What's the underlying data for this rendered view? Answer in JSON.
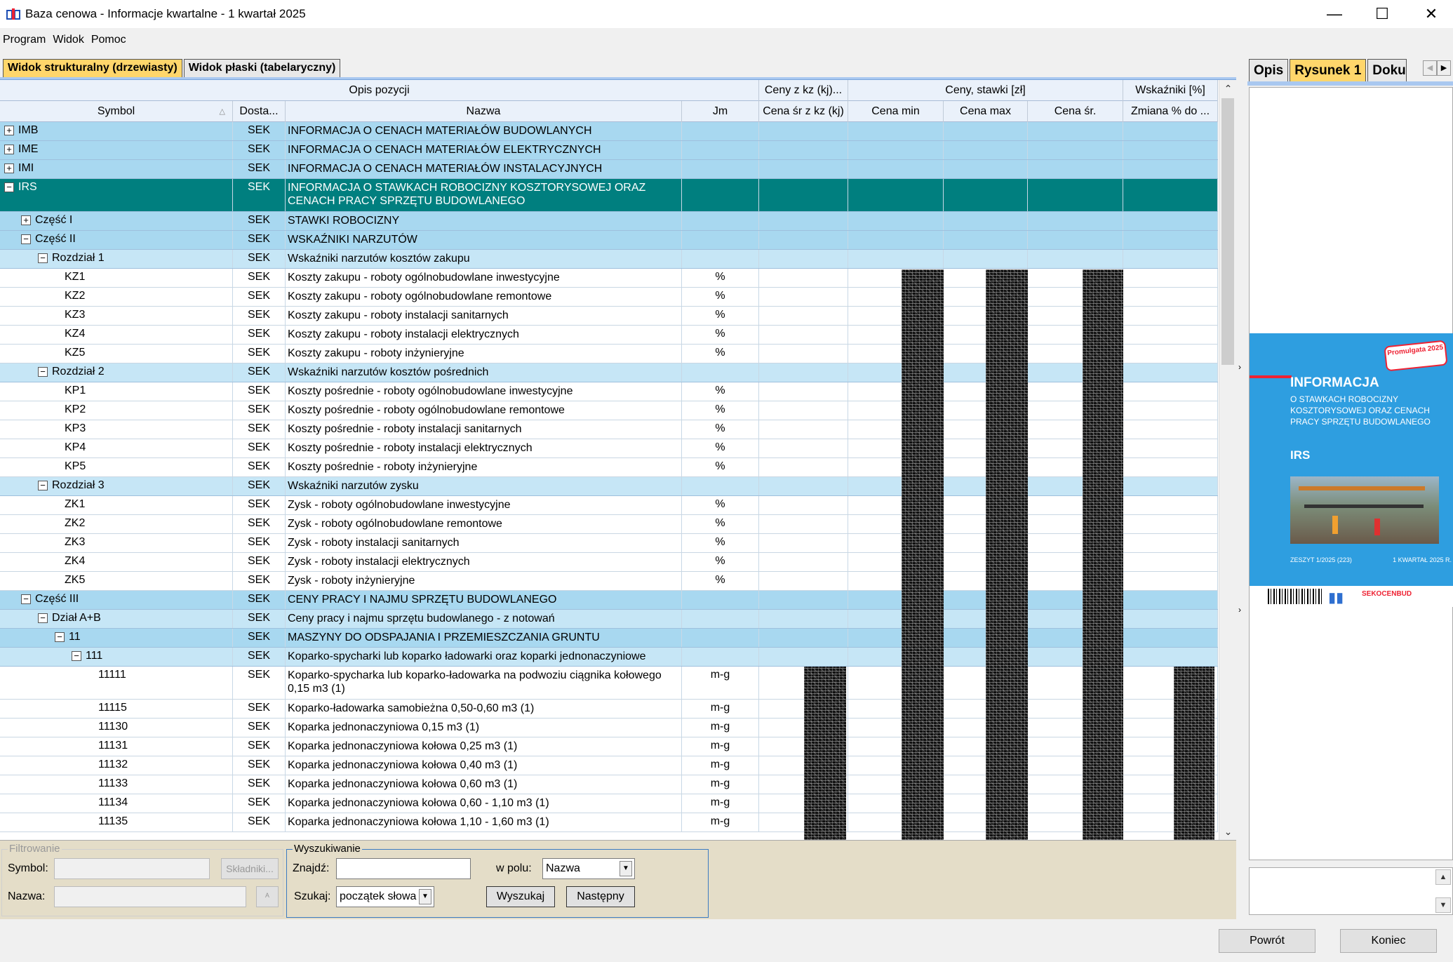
{
  "window": {
    "title": "Baza cenowa - Informacje kwartalne - 1 kwartał 2025",
    "minimize": "—",
    "maximize": "☐",
    "close": "✕"
  },
  "menu": [
    "Program",
    "Widok",
    "Pomoc"
  ],
  "tabs": [
    "Widok strukturalny (drzewiasty)",
    "Widok płaski (tabelaryczny)"
  ],
  "header_groups": [
    "Opis pozycji",
    "Ceny z kz (kj)...",
    "Ceny, stawki [zł]",
    "Wskaźniki [%]"
  ],
  "columns": [
    "Symbol",
    "Dosta...",
    "Nazwa",
    "Jm",
    "Cena śr z kz (kj)",
    "Cena min",
    "Cena max",
    "Cena śr.",
    "Zmiana % do ..."
  ],
  "rows": [
    {
      "level": 0,
      "sign": "+",
      "symbol": "IMB",
      "dost": "SEK",
      "name": "INFORMACJA O CENACH MATERIAŁÓW BUDOWLANYCH",
      "jm": "",
      "type": "grp"
    },
    {
      "level": 0,
      "sign": "+",
      "symbol": "IME",
      "dost": "SEK",
      "name": "INFORMACJA O CENACH MATERIAŁÓW ELEKTRYCZNYCH",
      "jm": "",
      "type": "grp"
    },
    {
      "level": 0,
      "sign": "+",
      "symbol": "IMI",
      "dost": "SEK",
      "name": "INFORMACJA O CENACH MATERIAŁÓW INSTALACYJNYCH",
      "jm": "",
      "type": "grp"
    },
    {
      "level": 0,
      "sign": "−",
      "symbol": "IRS",
      "dost": "SEK",
      "name": "INFORMACJA O STAWKACH ROBOCIZNY KOSZTORYSOWEJ ORAZ CENACH PRACY SPRZĘTU BUDOWLANEGO",
      "jm": "",
      "type": "sel"
    },
    {
      "level": 1,
      "sign": "+",
      "symbol": "Część I",
      "dost": "SEK",
      "name": "STAWKI ROBOCIZNY",
      "jm": "",
      "type": "grp"
    },
    {
      "level": 1,
      "sign": "−",
      "symbol": "Część II",
      "dost": "SEK",
      "name": "WSKAŹNIKI NARZUTÓW",
      "jm": "",
      "type": "grp"
    },
    {
      "level": 2,
      "sign": "−",
      "symbol": "Rozdział 1",
      "dost": "SEK",
      "name": "Wskaźniki narzutów kosztów zakupu",
      "jm": "",
      "type": "grp2"
    },
    {
      "level": 3,
      "sign": "",
      "symbol": "KZ1",
      "dost": "SEK",
      "name": "Koszty zakupu - roboty ogólnobudowlane inwestycyjne",
      "jm": "%",
      "type": "leaf"
    },
    {
      "level": 3,
      "sign": "",
      "symbol": "KZ2",
      "dost": "SEK",
      "name": "Koszty zakupu - roboty ogólnobudowlane remontowe",
      "jm": "%",
      "type": "leaf"
    },
    {
      "level": 3,
      "sign": "",
      "symbol": "KZ3",
      "dost": "SEK",
      "name": "Koszty zakupu - roboty instalacji sanitarnych",
      "jm": "%",
      "type": "leaf"
    },
    {
      "level": 3,
      "sign": "",
      "symbol": "KZ4",
      "dost": "SEK",
      "name": "Koszty zakupu - roboty instalacji elektrycznych",
      "jm": "%",
      "type": "leaf"
    },
    {
      "level": 3,
      "sign": "",
      "symbol": "KZ5",
      "dost": "SEK",
      "name": "Koszty zakupu - roboty inżynieryjne",
      "jm": "%",
      "type": "leaf"
    },
    {
      "level": 2,
      "sign": "−",
      "symbol": "Rozdział 2",
      "dost": "SEK",
      "name": "Wskaźniki narzutów kosztów pośrednich",
      "jm": "",
      "type": "grp2"
    },
    {
      "level": 3,
      "sign": "",
      "symbol": "KP1",
      "dost": "SEK",
      "name": "Koszty pośrednie - roboty ogólnobudowlane inwestycyjne",
      "jm": "%",
      "type": "leaf"
    },
    {
      "level": 3,
      "sign": "",
      "symbol": "KP2",
      "dost": "SEK",
      "name": "Koszty pośrednie - roboty ogólnobudowlane remontowe",
      "jm": "%",
      "type": "leaf"
    },
    {
      "level": 3,
      "sign": "",
      "symbol": "KP3",
      "dost": "SEK",
      "name": "Koszty pośrednie - roboty instalacji sanitarnych",
      "jm": "%",
      "type": "leaf"
    },
    {
      "level": 3,
      "sign": "",
      "symbol": "KP4",
      "dost": "SEK",
      "name": "Koszty pośrednie - roboty instalacji elektrycznych",
      "jm": "%",
      "type": "leaf"
    },
    {
      "level": 3,
      "sign": "",
      "symbol": "KP5",
      "dost": "SEK",
      "name": "Koszty pośrednie - roboty inżynieryjne",
      "jm": "%",
      "type": "leaf"
    },
    {
      "level": 2,
      "sign": "−",
      "symbol": "Rozdział 3",
      "dost": "SEK",
      "name": "Wskaźniki narzutów zysku",
      "jm": "",
      "type": "grp2"
    },
    {
      "level": 3,
      "sign": "",
      "symbol": "ZK1",
      "dost": "SEK",
      "name": "Zysk - roboty ogólnobudowlane inwestycyjne",
      "jm": "%",
      "type": "leaf"
    },
    {
      "level": 3,
      "sign": "",
      "symbol": "ZK2",
      "dost": "SEK",
      "name": "Zysk - roboty ogólnobudowlane remontowe",
      "jm": "%",
      "type": "leaf"
    },
    {
      "level": 3,
      "sign": "",
      "symbol": "ZK3",
      "dost": "SEK",
      "name": "Zysk - roboty instalacji sanitarnych",
      "jm": "%",
      "type": "leaf"
    },
    {
      "level": 3,
      "sign": "",
      "symbol": "ZK4",
      "dost": "SEK",
      "name": "Zysk - roboty instalacji elektrycznych",
      "jm": "%",
      "type": "leaf"
    },
    {
      "level": 3,
      "sign": "",
      "symbol": "ZK5",
      "dost": "SEK",
      "name": "Zysk - roboty inżynieryjne",
      "jm": "%",
      "type": "leaf"
    },
    {
      "level": 1,
      "sign": "−",
      "symbol": "Część III",
      "dost": "SEK",
      "name": "CENY PRACY I NAJMU SPRZĘTU BUDOWLANEGO",
      "jm": "",
      "type": "grp"
    },
    {
      "level": 2,
      "sign": "−",
      "symbol": "Dział A+B",
      "dost": "SEK",
      "name": "Ceny pracy i najmu sprzętu budowlanego - z notowań",
      "jm": "",
      "type": "grp2"
    },
    {
      "level": 3,
      "sign": "−",
      "symbol": "11",
      "dost": "SEK",
      "name": "MASZYNY DO ODSPAJANIA I PRZEMIESZCZANIA GRUNTU",
      "jm": "",
      "type": "grp"
    },
    {
      "level": 4,
      "sign": "−",
      "symbol": "111",
      "dost": "SEK",
      "name": "Koparko-spycharki lub koparko ładowarki oraz koparki jednonaczyniowe",
      "jm": "",
      "type": "grp2"
    },
    {
      "level": 5,
      "sign": "",
      "symbol": "11111",
      "dost": "SEK",
      "name": "Koparko-spycharka lub koparko-ładowarka na podwoziu ciągnika kołowego 0,15 m3 (1)",
      "jm": "m-g",
      "type": "leaf"
    },
    {
      "level": 5,
      "sign": "",
      "symbol": "11115",
      "dost": "SEK",
      "name": "Koparko-ładowarka samobieżna 0,50-0,60 m3 (1)",
      "jm": "m-g",
      "type": "leaf"
    },
    {
      "level": 5,
      "sign": "",
      "symbol": "11130",
      "dost": "SEK",
      "name": "Koparka jednonaczyniowa 0,15 m3 (1)",
      "jm": "m-g",
      "type": "leaf"
    },
    {
      "level": 5,
      "sign": "",
      "symbol": "11131",
      "dost": "SEK",
      "name": "Koparka jednonaczyniowa kołowa 0,25 m3 (1)",
      "jm": "m-g",
      "type": "leaf"
    },
    {
      "level": 5,
      "sign": "",
      "symbol": "11132",
      "dost": "SEK",
      "name": "Koparka jednonaczyniowa kołowa 0,40 m3 (1)",
      "jm": "m-g",
      "type": "leaf"
    },
    {
      "level": 5,
      "sign": "",
      "symbol": "11133",
      "dost": "SEK",
      "name": "Koparka jednonaczyniowa kołowa 0,60 m3 (1)",
      "jm": "m-g",
      "type": "leaf"
    },
    {
      "level": 5,
      "sign": "",
      "symbol": "11134",
      "dost": "SEK",
      "name": "Koparka jednonaczyniowa kołowa 0,60 - 1,10 m3 (1)",
      "jm": "m-g",
      "type": "leaf"
    },
    {
      "level": 5,
      "sign": "",
      "symbol": "11135",
      "dost": "SEK",
      "name": "Koparka jednonaczyniowa kołowa 1,10 - 1,60 m3 (1)",
      "jm": "m-g",
      "type": "leaf"
    }
  ],
  "filter": {
    "legend": "Filtrowanie",
    "symbol_label": "Symbol:",
    "nazwa_label": "Nazwa:",
    "skladniki": "Składniki...",
    "clear": "ᴬ"
  },
  "search": {
    "legend": "Wyszukiwanie",
    "find_label": "Znajdź:",
    "find_value": "",
    "field_label": "w polu:",
    "field_value": "Nazwa",
    "mode_label": "Szukaj:",
    "mode_value": "początek słowa",
    "search_btn": "Wyszukaj",
    "next_btn": "Następny"
  },
  "right_tabs": [
    "Opis",
    "Rysunek 1",
    "Doku"
  ],
  "cover": {
    "stamp": "Promulgata 2025",
    "title": "INFORMACJA",
    "subtitle": "O STAWKACH ROBOCIZNY KOSZTORYSOWEJ ORAZ CENACH PRACY SPRZĘTU BUDOWLANEGO",
    "code": "IRS",
    "footer_left": "ZESZYT 1/2025 (223)",
    "footer_right": "1 KWARTAŁ 2025 R.",
    "brand": "SEKOCENBUD"
  },
  "footer": {
    "back": "Powrót",
    "end": "Koniec"
  }
}
